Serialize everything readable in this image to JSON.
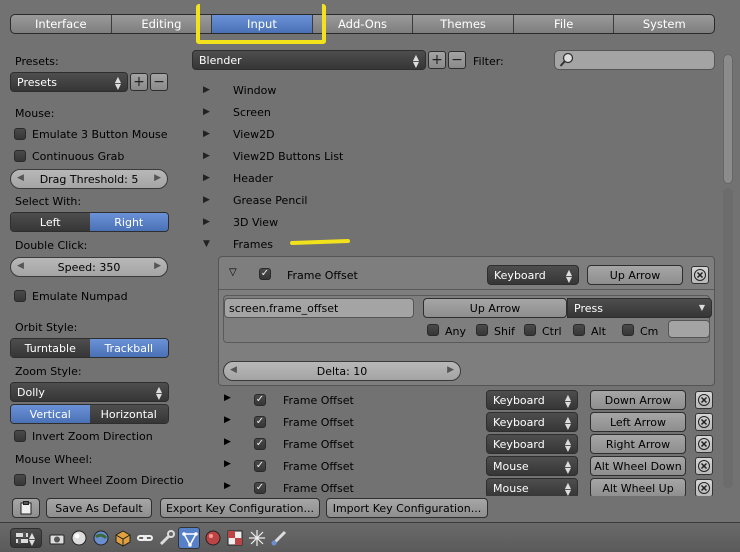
{
  "tabs": [
    {
      "label": "Interface",
      "active": false
    },
    {
      "label": "Editing",
      "active": false
    },
    {
      "label": "Input",
      "active": true
    },
    {
      "label": "Add-Ons",
      "active": false
    },
    {
      "label": "Themes",
      "active": false
    },
    {
      "label": "File",
      "active": false
    },
    {
      "label": "System",
      "active": false
    }
  ],
  "left": {
    "presets_label": "Presets:",
    "presets_value": "Presets",
    "mouse_label": "Mouse:",
    "emulate_3_button": "Emulate 3 Button Mouse",
    "continuous_grab": "Continuous Grab",
    "drag_threshold": "Drag Threshold: 5",
    "select_with_label": "Select With:",
    "select_left": "Left",
    "select_right": "Right",
    "double_click_label": "Double Click:",
    "speed": "Speed: 350",
    "emulate_numpad": "Emulate Numpad",
    "orbit_style_label": "Orbit Style:",
    "orbit_turntable": "Turntable",
    "orbit_trackball": "Trackball",
    "zoom_style_label": "Zoom Style:",
    "zoom_style_value": "Dolly",
    "zoom_vertical": "Vertical",
    "zoom_horizontal": "Horizontal",
    "invert_zoom": "Invert Zoom Direction",
    "mouse_wheel_label": "Mouse Wheel:",
    "invert_wheel": "Invert Wheel Zoom Directio"
  },
  "keymap": {
    "preset": "Blender",
    "filter_label": "Filter:",
    "filter_value": "",
    "tree": [
      "Window",
      "Screen",
      "View2D",
      "View2D Buttons List",
      "Header",
      "Grease Pencil",
      "3D View",
      "Frames"
    ]
  },
  "expanded": {
    "name": "Frame Offset",
    "device": "Keyboard",
    "key": "Up Arrow",
    "operator": "screen.frame_offset",
    "key_field": "Up Arrow",
    "event": "Press",
    "modifiers": [
      "Any",
      "Shif",
      "Ctrl",
      "Alt",
      "Cm"
    ],
    "delta": "Delta: 10"
  },
  "rows": [
    {
      "name": "Frame Offset",
      "device": "Keyboard",
      "key": "Down Arrow"
    },
    {
      "name": "Frame Offset",
      "device": "Keyboard",
      "key": "Left Arrow"
    },
    {
      "name": "Frame Offset",
      "device": "Keyboard",
      "key": "Right Arrow"
    },
    {
      "name": "Frame Offset",
      "device": "Mouse",
      "key": "Alt Wheel Down"
    },
    {
      "name": "Frame Offset",
      "device": "Mouse",
      "key": "Alt Wheel Up"
    }
  ],
  "bottom": {
    "save_default": "Save As Default",
    "export_keys": "Export Key Configuration...",
    "import_keys": "Import Key Configuration..."
  },
  "colors": {
    "accent": "#5680c8",
    "annotation": "#f2e21c"
  }
}
